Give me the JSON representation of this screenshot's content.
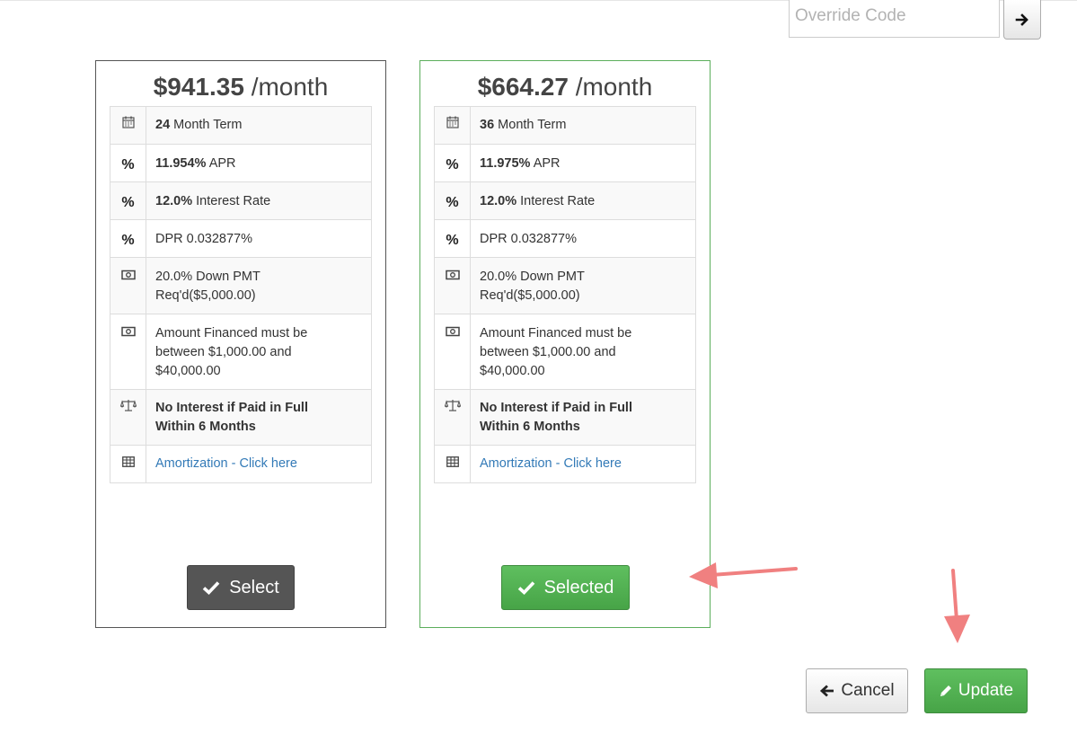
{
  "override": {
    "placeholder": "Override Code",
    "go_icon": "arrow-right-icon"
  },
  "plans": [
    {
      "amount": "$941.35",
      "period": "/month",
      "term_value": "24",
      "term_label": "Month Term",
      "apr_value": "11.954%",
      "apr_label": "APR",
      "interest_value": "12.0%",
      "interest_label": "Interest Rate",
      "dpr": "DPR 0.032877%",
      "down_line1": "20.0% Down PMT",
      "down_line2": "Req'd($5,000.00)",
      "financed_line1": "Amount Financed must be",
      "financed_line2": "between $1,000.00 and",
      "financed_line3": "$40,000.00",
      "promo_line1": "No Interest if Paid in Full",
      "promo_line2": "Within 6 Months",
      "amortization_link": "Amortization - Click here",
      "button_label": "Select",
      "selected": false
    },
    {
      "amount": "$664.27",
      "period": "/month",
      "term_value": "36",
      "term_label": "Month Term",
      "apr_value": "11.975%",
      "apr_label": "APR",
      "interest_value": "12.0%",
      "interest_label": "Interest Rate",
      "dpr": "DPR 0.032877%",
      "down_line1": "20.0% Down PMT",
      "down_line2": "Req'd($5,000.00)",
      "financed_line1": "Amount Financed must be",
      "financed_line2": "between $1,000.00 and",
      "financed_line3": "$40,000.00",
      "promo_line1": "No Interest if Paid in Full",
      "promo_line2": "Within 6 Months",
      "amortization_link": "Amortization - Click here",
      "button_label": "Selected",
      "selected": true
    }
  ],
  "icons": {
    "term": "calendar-icon",
    "rate": "percent-icon",
    "money": "money-icon",
    "promo": "balance-scale-icon",
    "amortization": "table-icon",
    "check": "check-icon"
  },
  "footer": {
    "cancel_label": "Cancel",
    "update_label": "Update",
    "cancel_icon": "arrow-left-icon",
    "update_icon": "pencil-icon"
  },
  "colors": {
    "selected_green": "#4cae4c",
    "select_dark": "#555555",
    "link_blue": "#337ab7",
    "annotation_red": "#f08080"
  }
}
